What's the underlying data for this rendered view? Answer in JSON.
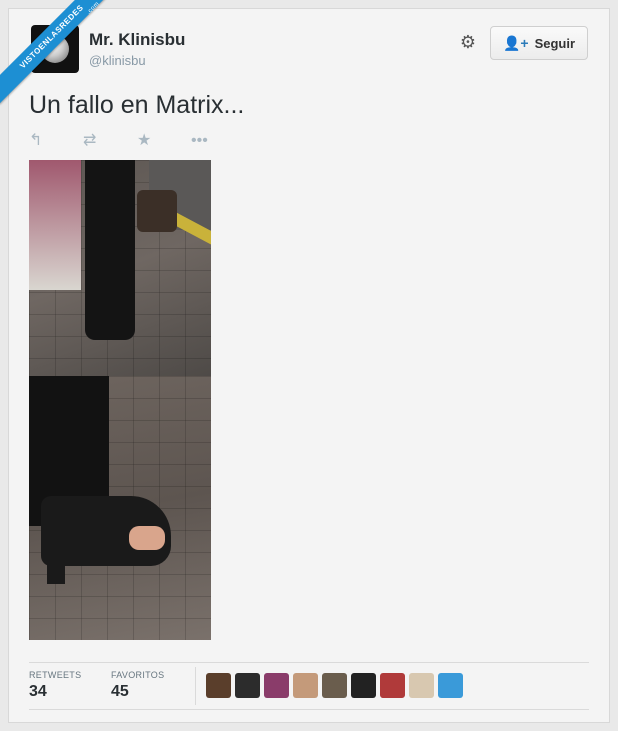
{
  "watermark": {
    "text": "VISTOENLASREDES",
    "sub": ".com"
  },
  "profile": {
    "name": "Mr. Klinisbu",
    "handle": "@klinisbu"
  },
  "header": {
    "follow_label": "Seguir"
  },
  "tweet": {
    "text": "Un fallo en Matrix..."
  },
  "stats": {
    "retweets_label": "RETWEETS",
    "retweets_count": "34",
    "favorites_label": "FAVORITOS",
    "favorites_count": "45"
  },
  "icons": {
    "gear": "gear-icon",
    "follow": "add-user-icon",
    "reply": "reply-icon",
    "retweet": "retweet-icon",
    "favorite": "star-icon",
    "more": "more-icon"
  },
  "colors": {
    "accent": "#2b7bb9",
    "ribbon": "#1d8fd3",
    "text": "#292f33",
    "muted": "#8899a6"
  },
  "favoriters": [
    {
      "name": "avatar-1",
      "color": "#5a3e2b"
    },
    {
      "name": "avatar-2",
      "color": "#2c2c2c"
    },
    {
      "name": "avatar-3",
      "color": "#8a3c6a"
    },
    {
      "name": "avatar-4",
      "color": "#c49a7a"
    },
    {
      "name": "avatar-5",
      "color": "#6a5d4d"
    },
    {
      "name": "avatar-6",
      "color": "#222222"
    },
    {
      "name": "avatar-7",
      "color": "#b03a3a"
    },
    {
      "name": "avatar-8",
      "color": "#d8c8b0"
    },
    {
      "name": "avatar-9",
      "color": "#3a9ad9"
    }
  ]
}
